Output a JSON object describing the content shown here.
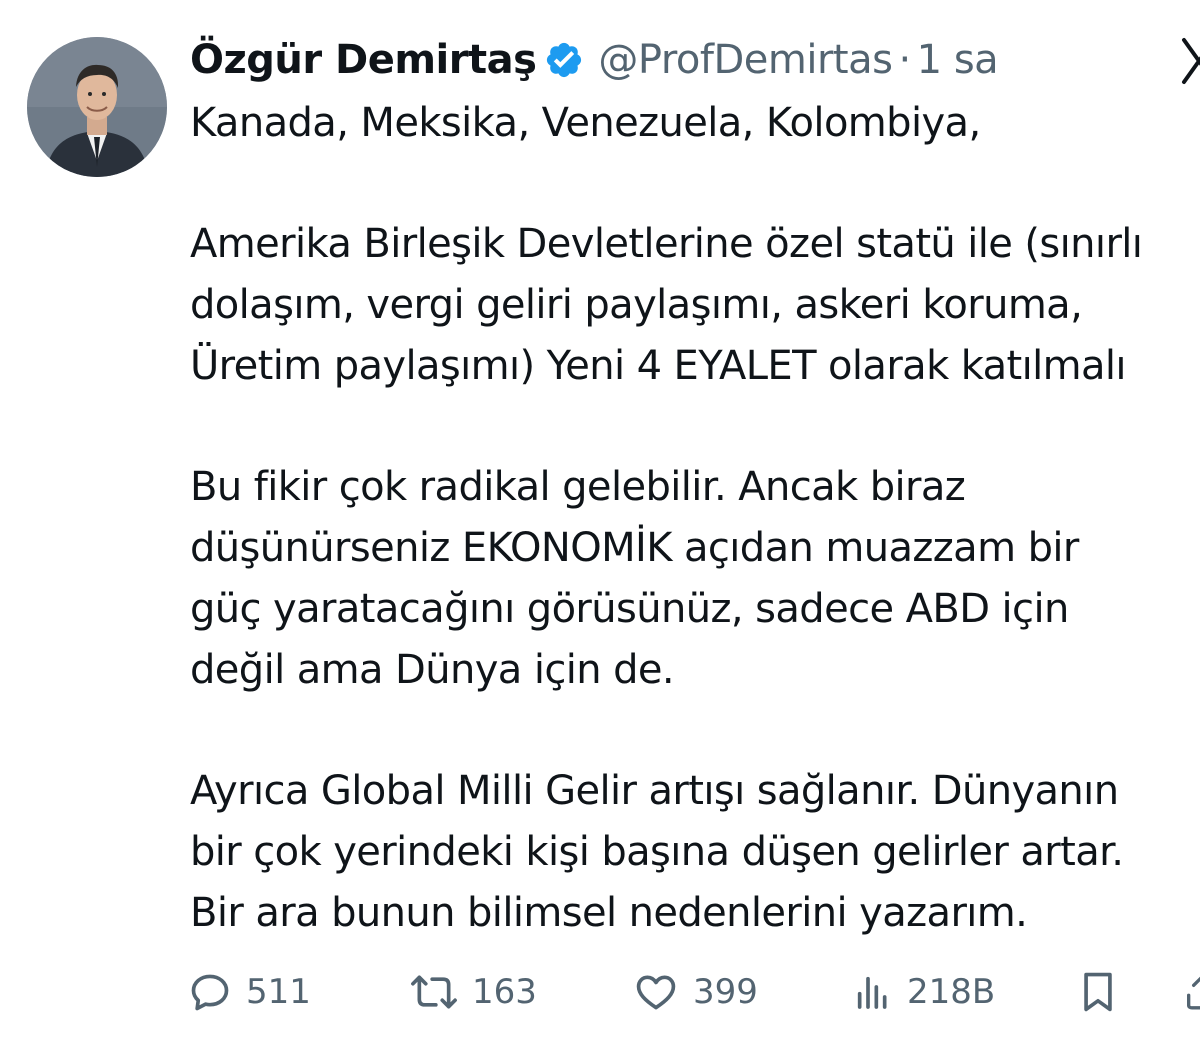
{
  "tweet": {
    "author": {
      "display_name": "Özgür Demirtaş",
      "handle": "@ProfDemirtas",
      "verified": true,
      "avatar": "profile-photo"
    },
    "separator": "·",
    "time": "1 sa",
    "text_lines": [
      "Kanada, Meksika, Venezuela, Kolombiya,",
      "",
      "Amerika Birleşik Devletlerine özel statü ile (sınırlı",
      "dolaşım,  vergi geliri paylaşımı, askeri koruma,",
      "Üretim paylaşımı) Yeni 4 EYALET olarak katılmalı",
      "",
      "Bu fikir çok radikal gelebilir. Ancak biraz",
      "düşünürseniz EKONOMİK açıdan muazzam bir",
      "güç yaratacağını görüsünüz, sadece ABD için",
      "değil ama Dünya için de.",
      "",
      "Ayrıca Global Milli Gelir artışı sağlanır. Dünyanın",
      "bir çok yerindeki kişi başına düşen gelirler artar.",
      "Bir ara bunun bilimsel nedenlerini yazarım."
    ],
    "actions": {
      "reply": {
        "icon": "reply-icon",
        "count": "511"
      },
      "retweet": {
        "icon": "retweet-icon",
        "count": "163"
      },
      "like": {
        "icon": "heart-icon",
        "count": "399"
      },
      "views": {
        "icon": "views-icon",
        "count": "218B"
      },
      "bookmark": {
        "icon": "bookmark-icon"
      },
      "share": {
        "icon": "share-icon"
      }
    }
  },
  "colors": {
    "text_primary": "#0f1419",
    "text_secondary": "#536471",
    "verified_badge": "#1d9bf0",
    "background": "#ffffff"
  }
}
